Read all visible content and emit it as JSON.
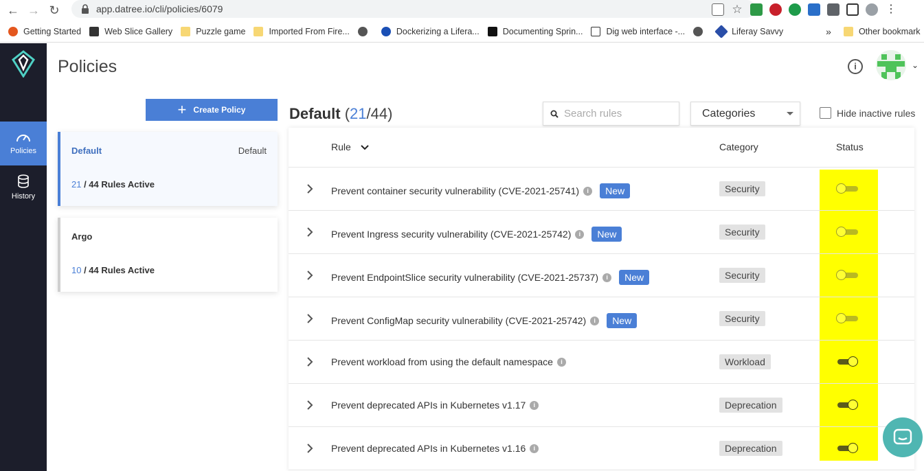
{
  "browser": {
    "url": "app.datree.io/cli/policies/6079",
    "bookmarks": [
      {
        "label": "Getting Started",
        "icon": "firefox-icon"
      },
      {
        "label": "Web Slice Gallery",
        "icon": "web-slice-icon"
      },
      {
        "label": "Puzzle game",
        "icon": "folder-icon"
      },
      {
        "label": "Imported From Fire...",
        "icon": "folder-icon"
      },
      {
        "label": "",
        "icon": "globe-icon"
      },
      {
        "label": "Dockerizing a Lifera...",
        "icon": "liferay-icon"
      },
      {
        "label": "Documenting Sprin...",
        "icon": "medium-icon"
      },
      {
        "label": "Dig web interface -...",
        "icon": "dig-icon"
      },
      {
        "label": "",
        "icon": "globe-icon"
      },
      {
        "label": "Liferay Savvy",
        "icon": "liferay-savvy-icon"
      }
    ],
    "more_bookmarks": "»",
    "other_bookmarks": "Other bookmark"
  },
  "sidenav": {
    "items": [
      {
        "label": "Policies",
        "icon": "gauge-icon",
        "active": true
      },
      {
        "label": "History",
        "icon": "database-icon",
        "active": false
      }
    ]
  },
  "header": {
    "title": "Policies"
  },
  "left": {
    "create_label": "Create Policy",
    "policies": [
      {
        "name": "Default",
        "tag": "Default",
        "active_count": "21",
        "rest": " / 44 Rules Active",
        "selected": true
      },
      {
        "name": "Argo",
        "tag": "",
        "active_count": "10",
        "rest": " / 44 Rules Active",
        "selected": false
      }
    ]
  },
  "main": {
    "title": "Default",
    "paren_open": "(",
    "active": "21",
    "total": "/44",
    "paren_close": ")",
    "search_placeholder": "Search rules",
    "categories_label": "Categories",
    "hide_inactive_label": "Hide inactive rules",
    "columns": {
      "rule": "Rule",
      "category": "Category",
      "status": "Status"
    },
    "rules": [
      {
        "name": "Prevent container security vulnerability (CVE-2021-25741)",
        "new": "New",
        "category": "Security",
        "enabled": false
      },
      {
        "name": "Prevent Ingress security vulnerability (CVE-2021-25742)",
        "new": "New",
        "category": "Security",
        "enabled": false
      },
      {
        "name": "Prevent EndpointSlice security vulnerability (CVE-2021-25737)",
        "new": "New",
        "category": "Security",
        "enabled": false
      },
      {
        "name": "Prevent ConfigMap security vulnerability (CVE-2021-25742)",
        "new": "New",
        "category": "Security",
        "enabled": false
      },
      {
        "name": "Prevent workload from using the default namespace",
        "new": "",
        "category": "Workload",
        "enabled": true
      },
      {
        "name": "Prevent deprecated APIs in Kubernetes v1.17",
        "new": "",
        "category": "Deprecation",
        "enabled": true
      },
      {
        "name": "Prevent deprecated APIs in Kubernetes v1.16",
        "new": "",
        "category": "Deprecation",
        "enabled": true
      }
    ]
  },
  "colors": {
    "accent": "#4a7fd6",
    "sidenav": "#1c1e2b",
    "highlight": "#ffff00",
    "chat": "#4fb6b2"
  }
}
